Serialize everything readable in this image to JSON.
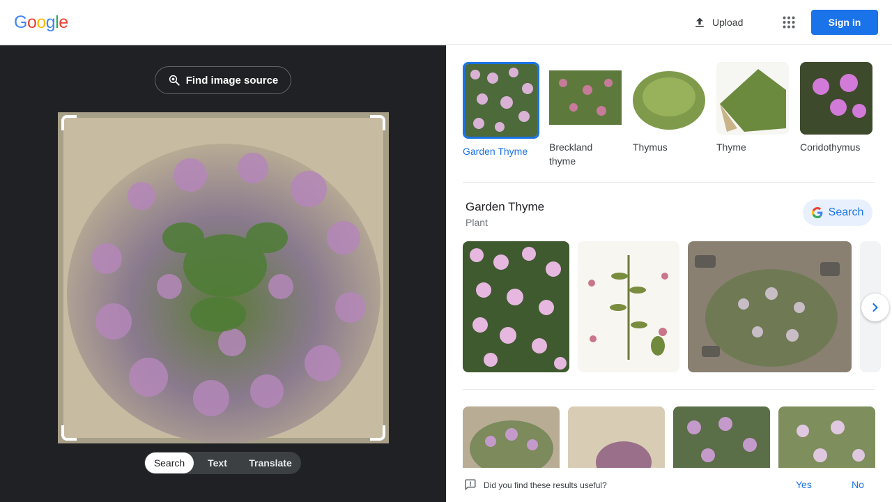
{
  "header": {
    "logo_letters": [
      {
        "ch": "G",
        "color": "#4285f4"
      },
      {
        "ch": "o",
        "color": "#ea4335"
      },
      {
        "ch": "o",
        "color": "#fbbc05"
      },
      {
        "ch": "g",
        "color": "#4285f4"
      },
      {
        "ch": "l",
        "color": "#34a853"
      },
      {
        "ch": "e",
        "color": "#ea4335"
      }
    ],
    "upload_label": "Upload",
    "apps_icon": "apps-grid-icon",
    "signin_label": "Sign in"
  },
  "left": {
    "find_source_label": "Find image source",
    "modes": [
      "Search",
      "Text",
      "Translate"
    ],
    "active_mode": "Search"
  },
  "right": {
    "chips": [
      {
        "label": "Garden Thyme",
        "selected": true
      },
      {
        "label": "Breckland thyme",
        "selected": false
      },
      {
        "label": "Thymus",
        "selected": false
      },
      {
        "label": "Thyme",
        "selected": false
      },
      {
        "label": "Coridothymus",
        "selected": false
      }
    ],
    "knowledge": {
      "title": "Garden Thyme",
      "subtitle": "Plant",
      "search_label": "Search"
    },
    "feedback": {
      "question": "Did you find these results useful?",
      "yes": "Yes",
      "no": "No"
    }
  },
  "colors": {
    "accent": "#1a73e8",
    "dark_pane": "#202124"
  }
}
